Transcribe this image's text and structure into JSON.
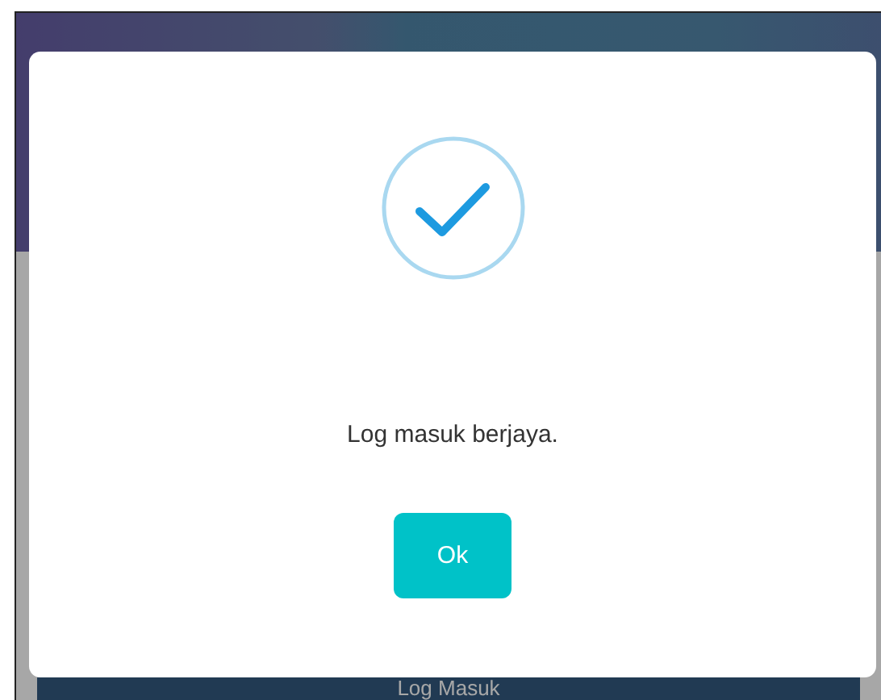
{
  "background": {
    "submit_button": "Log Masuk"
  },
  "dialog": {
    "kind": "success",
    "message": "Log masuk berjaya.",
    "button": "Ok"
  }
}
